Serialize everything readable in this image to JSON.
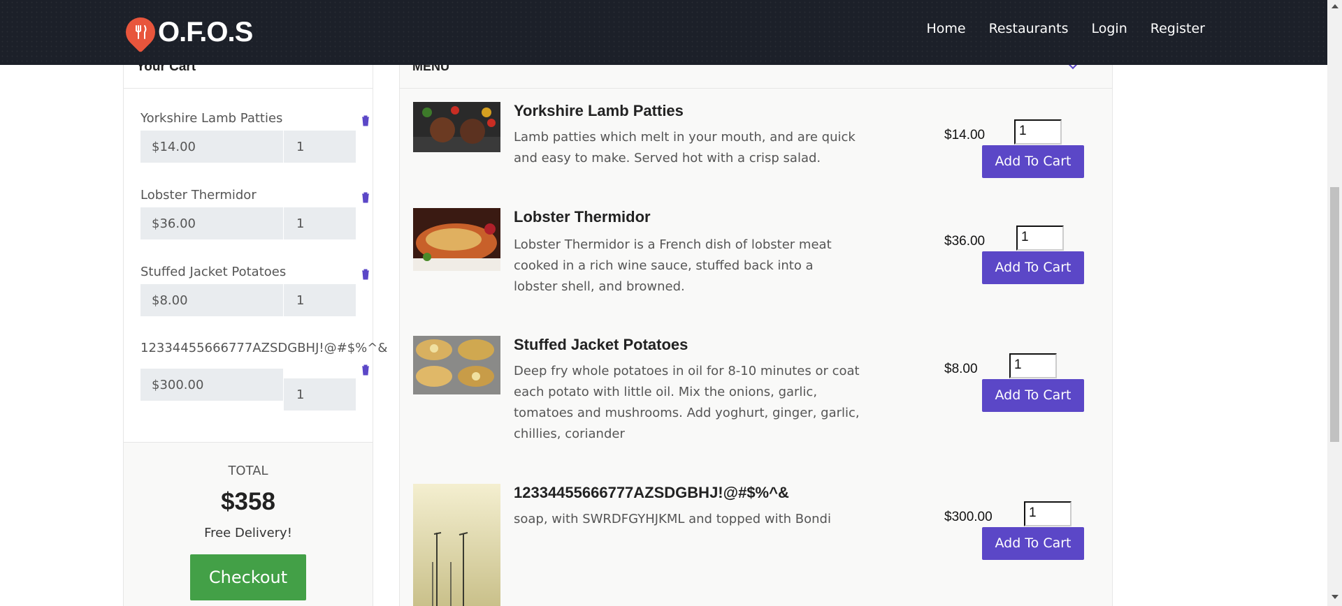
{
  "brand": {
    "name": "O.F.O.S"
  },
  "nav": {
    "home": "Home",
    "restaurants": "Restaurants",
    "login": "Login",
    "register": "Register"
  },
  "cart": {
    "title": "Your Cart",
    "items": [
      {
        "name": "Yorkshire Lamb Patties",
        "price": "$14.00",
        "qty": "1"
      },
      {
        "name": "Lobster Thermidor",
        "price": "$36.00",
        "qty": "1"
      },
      {
        "name": "Stuffed Jacket Potatoes",
        "price": "$8.00",
        "qty": "1"
      },
      {
        "name": "12334455666777AZSDGBHJ!@#$%^&",
        "price": "$300.00",
        "qty": "1"
      }
    ],
    "total_label": "TOTAL",
    "total_value": "$358",
    "delivery": "Free Delivery!",
    "checkout_label": "Checkout"
  },
  "menu": {
    "title": "MENU",
    "add_label": "Add To Cart",
    "items": [
      {
        "title": "Yorkshire Lamb Patties",
        "desc": "Lamb patties which melt in your mouth, and are quick and easy to make. Served hot with a crisp salad.",
        "price": "$14.00",
        "qty": "1"
      },
      {
        "title": "Lobster Thermidor",
        "desc": "Lobster Thermidor is a French dish of lobster meat cooked in a rich wine sauce, stuffed back into a lobster shell, and browned.",
        "price": "$36.00",
        "qty": "1"
      },
      {
        "title": "Stuffed Jacket Potatoes",
        "desc": "Deep fry whole potatoes in oil for 8-10 minutes or coat each potato with little oil. Mix the onions, garlic, tomatoes and mushrooms. Add yoghurt, ginger, garlic, chillies, coriander",
        "price": "$8.00",
        "qty": "1"
      },
      {
        "title": "12334455666777AZSDGBHJ!@#$%^&",
        "desc": "soap, with SWRDFGYHJKML and topped with Bondi",
        "price": "$300.00",
        "qty": "1"
      }
    ]
  },
  "colors": {
    "accent": "#5b47c7",
    "checkout": "#43a047",
    "header": "#1c2029",
    "logo": "#e8553c"
  }
}
